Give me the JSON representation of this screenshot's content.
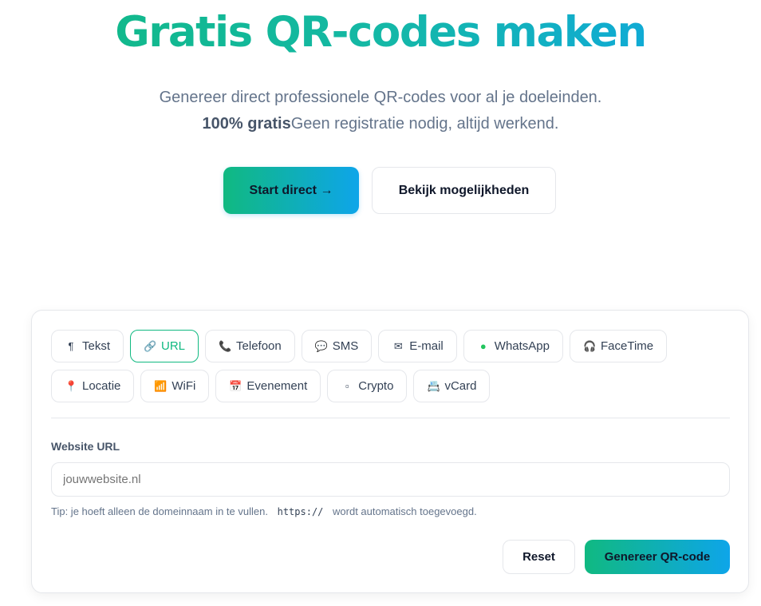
{
  "hero": {
    "title": "Gratis QR-codes maken",
    "subtitle_line1": "Genereer direct professionele QR-codes voor al je doeleinden.",
    "subtitle_strong": "100% gratis",
    "subtitle_line2": "Geen registratie nodig, altijd werkend.",
    "start_button": "Start direct →",
    "explore_button": "Bekijk mogelijkheden"
  },
  "tabs": [
    {
      "icon": "¶",
      "icon_name": "pilcrow-icon",
      "label": "Tekst",
      "active": false
    },
    {
      "icon": "🔗",
      "icon_name": "link-icon",
      "label": "URL",
      "active": true
    },
    {
      "icon": "📞",
      "icon_name": "phone-icon",
      "label": "Telefoon",
      "active": false
    },
    {
      "icon": "💬",
      "icon_name": "chat-bubble-icon",
      "label": "SMS",
      "active": false
    },
    {
      "icon": "✉",
      "icon_name": "envelope-icon",
      "label": "E-mail",
      "active": false
    },
    {
      "icon": "●",
      "icon_name": "whatsapp-icon",
      "label": "WhatsApp",
      "active": false
    },
    {
      "icon": "🎧",
      "icon_name": "headphones-icon",
      "label": "FaceTime",
      "active": false
    },
    {
      "icon": "📍",
      "icon_name": "map-pin-icon",
      "label": "Locatie",
      "active": false
    },
    {
      "icon": "📶",
      "icon_name": "wifi-signal-icon",
      "label": "WiFi",
      "active": false
    },
    {
      "icon": "📅",
      "icon_name": "calendar-icon",
      "label": "Evenement",
      "active": false
    },
    {
      "icon": "▫",
      "icon_name": "crypto-icon",
      "label": "Crypto",
      "active": false
    },
    {
      "icon": "📇",
      "icon_name": "contact-card-icon",
      "label": "vCard",
      "active": false
    }
  ],
  "form": {
    "label": "Website URL",
    "placeholder": "jouwwebsite.nl",
    "value": "",
    "tip_before": "Tip: je hoeft alleen de domeinnaam in te vullen.",
    "tip_code": "https://",
    "tip_after": "wordt automatisch toegevoegd.",
    "reset_button": "Reset",
    "generate_button": "Genereer QR-code"
  },
  "colors": {
    "accent_green": "#10b981",
    "accent_blue": "#0ea5e9",
    "whatsapp": "#22c55e"
  }
}
